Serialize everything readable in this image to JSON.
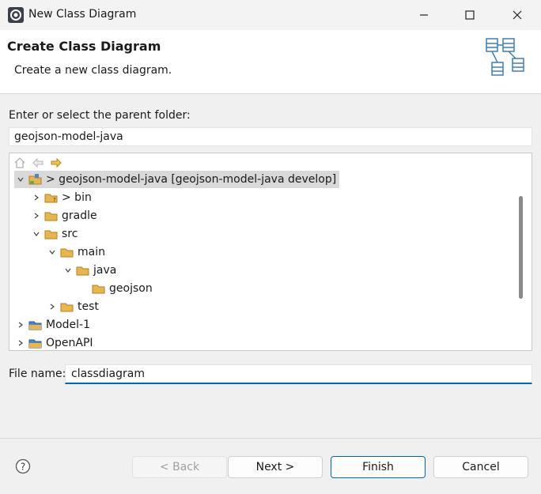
{
  "window": {
    "title": "New Class Diagram"
  },
  "banner": {
    "title": "Create Class Diagram",
    "description": "Create a new class diagram."
  },
  "folder": {
    "label": "Enter or select the parent folder:",
    "value": "geojson-model-java"
  },
  "tree": {
    "items": [
      {
        "label": "> geojson-model-java [geojson-model-java develop]",
        "expanded": true,
        "selected": true,
        "icon": "project-folder-icon"
      },
      {
        "label": "> bin",
        "expanded": false,
        "icon": "folder-icon"
      },
      {
        "label": "gradle",
        "expanded": false,
        "icon": "folder-icon"
      },
      {
        "label": "src",
        "expanded": true,
        "icon": "folder-icon"
      },
      {
        "label": "main",
        "expanded": true,
        "icon": "folder-icon"
      },
      {
        "label": "java",
        "expanded": true,
        "icon": "folder-icon"
      },
      {
        "label": "geojson",
        "icon": "folder-icon"
      },
      {
        "label": "test",
        "expanded": false,
        "icon": "folder-icon"
      },
      {
        "label": "Model-1",
        "expanded": false,
        "icon": "project-closed-icon"
      },
      {
        "label": "OpenAPI",
        "expanded": false,
        "icon": "project-closed-icon"
      }
    ]
  },
  "file": {
    "label": "File name:",
    "value": "classdiagram"
  },
  "buttons": {
    "back": "< Back",
    "next": "Next >",
    "finish": "Finish",
    "cancel": "Cancel"
  },
  "colors": {
    "accent": "#0067c0",
    "folder": "#e8b64c"
  }
}
